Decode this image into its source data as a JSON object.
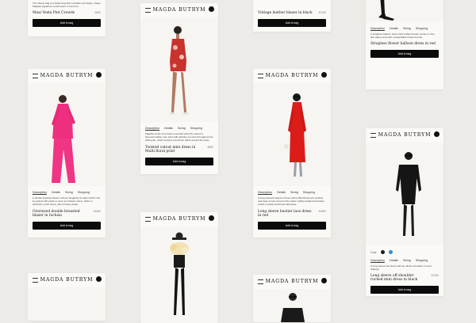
{
  "brand": "MAGDA BUTRYM",
  "tabs": [
    "Description",
    "Details",
    "Sizing",
    "Shopping"
  ],
  "add_to_bag": "Add to bag",
  "cards": {
    "c1": {
      "desc": "The Vaccio bag is a folder bag with a double pull straps, shape Magdas signature orchid sewn to the front.",
      "name": "Maxi Vesta Pint Crowds",
      "price": "£890"
    },
    "c2": {
      "desc": "A double breasted blazer with an elegantly cut lapel which can be paired with pants or worn as a blazer dress. Tailor to perfection, pink tones, plus a heavy drape.",
      "name": "Oversized double breasted blazer in fuchsia",
      "price": "£1690"
    },
    "c3": {
      "desc": "Magdas iconic mini dress executed with this season's favoured Italian rose print with delicate cut-outs throughout the silhouette, which creates a feminine effect around the body.",
      "name": "Twisted cutout mini dress in Multi floral print",
      "price": "£890"
    },
    "c4": {
      "name": "Vintage leather blazer in black",
      "price": "£2190"
    },
    "c5": {
      "desc": "A long sleeved bodycon dress with a fitted flounced neckline and deep scoop cutout at the waist. Lightly padded shoulders create a sharp structured silhouette.",
      "name": "Long sleeve bustier lace dress in red",
      "price": "£1850"
    },
    "c6": {
      "desc": "A strapless balloon dress with a fitted bustier section in fine silk sateen and with a detachable flower brooch.",
      "name": "Strapless flower balloon dress in red",
      "price": "£1290"
    },
    "c7": {
      "color_label": "Color",
      "colors": [
        "#1c1c1c",
        "#2e8fd6"
      ],
      "desc": "A long sleeve knit dress with an off-the-shoulder cut and draping",
      "name": "Long sleeve off shoulder ruched mini dress in black",
      "price": "£1250"
    }
  },
  "colors": {
    "background": "#ecebe7",
    "card": "#faf9f6",
    "button": "#0b0b0b",
    "accent_pink": "#ee2f80",
    "accent_red": "#dc1c18"
  }
}
